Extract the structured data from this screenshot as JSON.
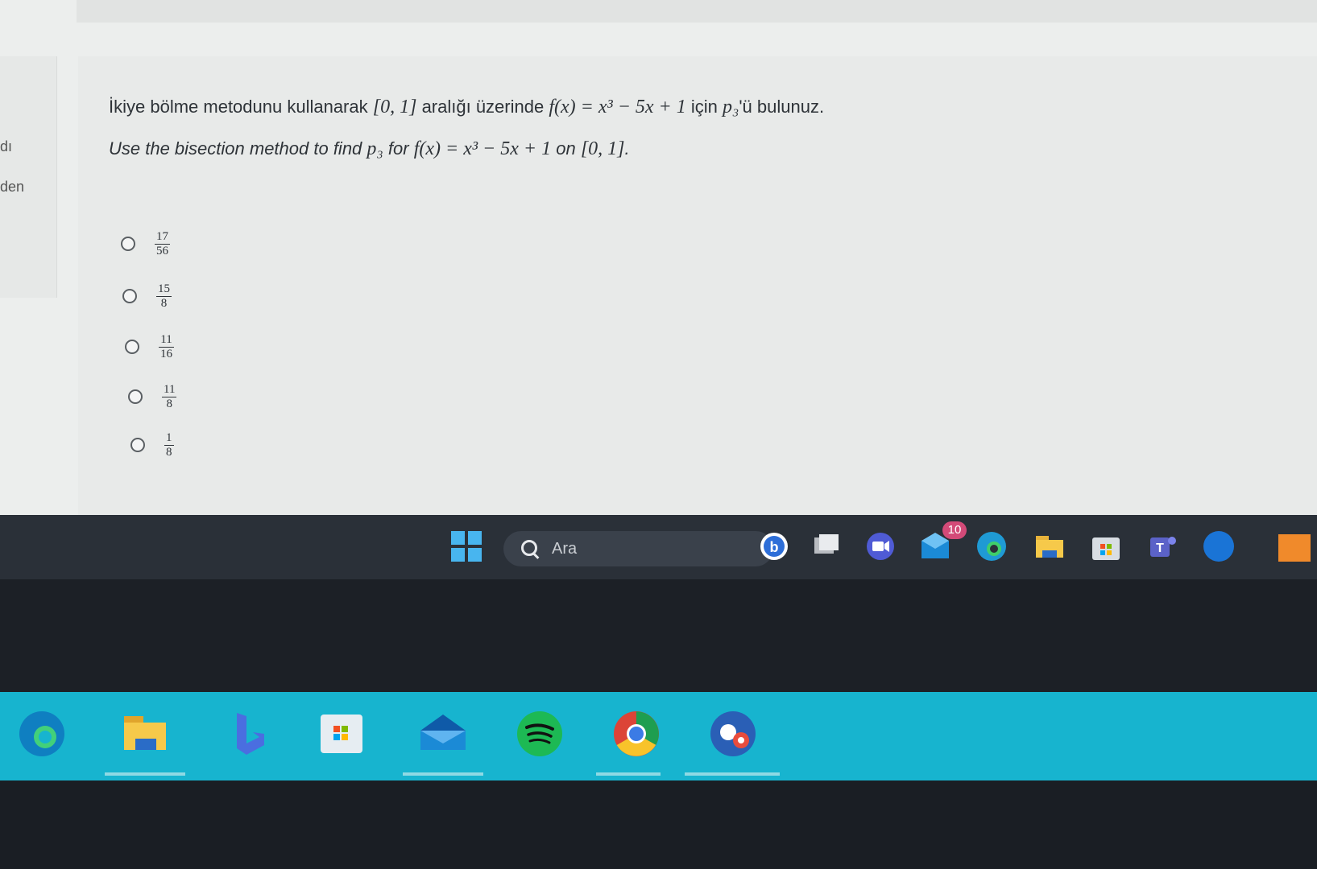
{
  "left_labels": [
    "dı",
    "den"
  ],
  "question": {
    "tr_text": "İkiye bölme metodunu kullanarak",
    "tr_interval": "[0, 1]",
    "tr_mid": "aralığı üzerinde",
    "tr_func": "f(x) = x³ − 5x + 1",
    "tr_for": "için",
    "tr_p": "p₃",
    "tr_end": "'ü bulunuz.",
    "en_text": "Use the bisection method to find",
    "en_p": "p₃",
    "en_for": "for",
    "en_func": "f(x) = x³ − 5x + 1",
    "en_on": "on",
    "en_interval": "[0, 1]",
    "en_end": "."
  },
  "choices": [
    {
      "num": "17",
      "den": "56"
    },
    {
      "num": "15",
      "den": "8"
    },
    {
      "num": "11",
      "den": "16"
    },
    {
      "num": "11",
      "den": "8"
    },
    {
      "num": "1",
      "den": "8"
    }
  ],
  "taskbar": {
    "search_placeholder": "Ara",
    "mail_badge": "10",
    "start_color": "#48b5ef"
  },
  "dock_apps": [
    "edge-icon",
    "file-explorer-icon",
    "bing-icon",
    "calculator-icon",
    "mail-icon",
    "spotify-icon",
    "chrome-icon",
    "photos-icon"
  ]
}
